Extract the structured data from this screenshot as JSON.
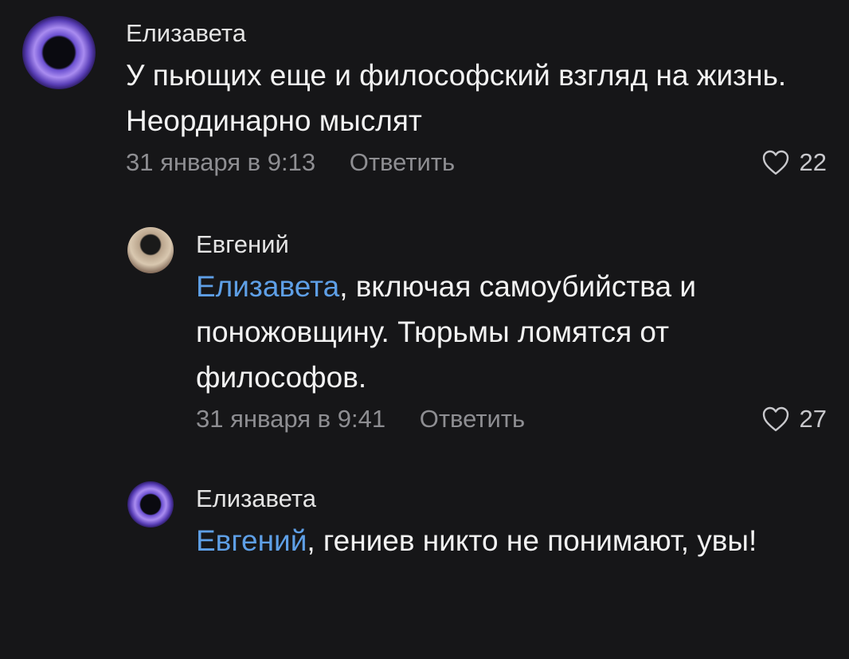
{
  "comments": [
    {
      "author": "Елизавета",
      "mention": "",
      "text": "У пьющих еще и философский взгляд на жизнь. Неординарно мыслят",
      "date": "31 января в 9:13",
      "reply_label": "Ответить",
      "likes": "22"
    },
    {
      "author": "Евгений",
      "mention": "Елизавета",
      "text": ", включая самоубийства и поножовщину. Тюрьмы ломятся от философов.",
      "date": "31 января в 9:41",
      "reply_label": "Ответить",
      "likes": "27"
    },
    {
      "author": "Елизавета",
      "mention": "Евгений",
      "text": ", гениев никто не понимают, увы!"
    }
  ],
  "icons": {
    "like": "heart-outline-icon"
  },
  "colors": {
    "background": "#161618",
    "mention": "#5e9fe6",
    "meta": "#8e8e92"
  }
}
